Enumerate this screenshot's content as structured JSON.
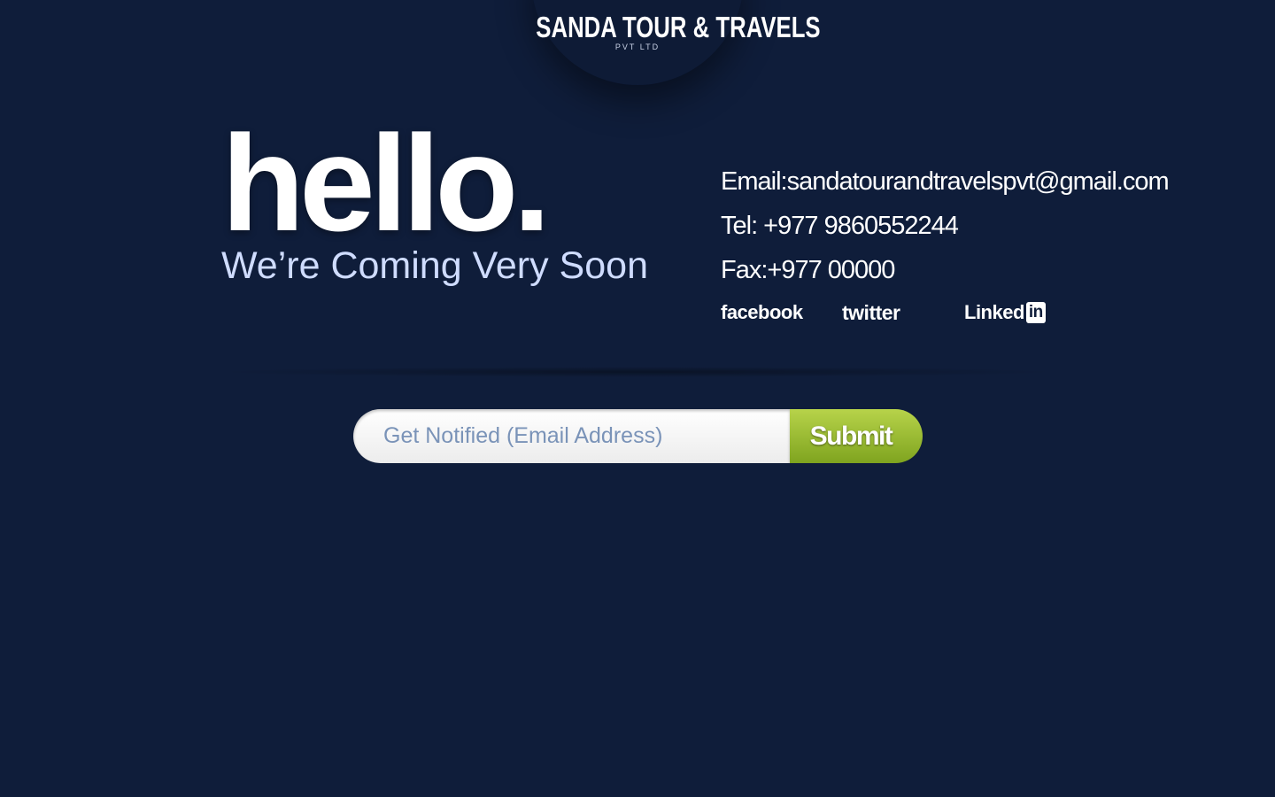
{
  "logo": {
    "title": "SANDA TOUR & TRAVELS",
    "subtitle": "PVT LTD"
  },
  "hero": {
    "headline": "hello.",
    "subtitle": "We’re Coming Very Soon"
  },
  "contact": {
    "email": "Email:sandatourandtravelspvt@gmail.com",
    "tel": "Tel: +977 9860552244",
    "fax": "Fax:+977 00000"
  },
  "social": {
    "facebook": "facebook",
    "twitter": "twitter",
    "linkedin_text": "Linked",
    "linkedin_box": "in"
  },
  "form": {
    "placeholder": "Get Notified (Email Address)",
    "submit_label": "Submit"
  },
  "colors": {
    "background": "#0f1d3a",
    "subtitle": "#cfdcff",
    "submit_top": "#b7d34a",
    "submit_bottom": "#7fa41f",
    "placeholder": "#7a93b8"
  }
}
